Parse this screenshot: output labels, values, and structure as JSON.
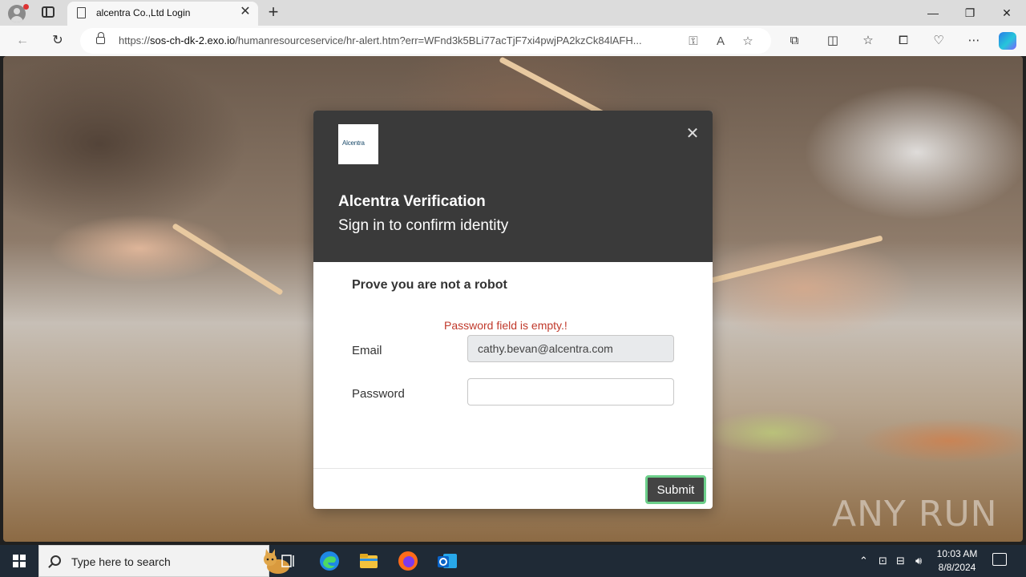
{
  "browser": {
    "tab_title": "alcentra Co.,Ltd Login",
    "url_scheme": "https://",
    "url_host": "sos-ch-dk-2.exo.io",
    "url_path": "/humanresourceservice/hr-alert.htm?err=WFnd3k5BLi77acTjF7xi4pwjPA2kzCk84lAFH...",
    "new_tab_symbol": "+",
    "close_tab_symbol": "✕"
  },
  "dialog": {
    "logo_text": "Alcentra",
    "title": "Alcentra Verification",
    "subtitle": "Sign in to confirm identity",
    "heading": "Prove you are not a robot",
    "error": "Password field is empty.!",
    "email_label": "Email",
    "email_value": "cathy.bevan@alcentra.com",
    "password_label": "Password",
    "password_value": "",
    "submit_label": "Submit",
    "close_symbol": "✕"
  },
  "watermark": "ANY RUN",
  "taskbar": {
    "search_placeholder": "Type here to search",
    "time": "10:03 AM",
    "date": "8/8/2024"
  },
  "colors": {
    "dialog_header": "#3a3a3a",
    "error": "#c0392b",
    "submit_bg": "#444444",
    "submit_border": "#6ccf8a",
    "taskbar": "#1f2a36"
  },
  "icons": [
    "profile-icon",
    "tabs-icon",
    "page-icon",
    "close-icon",
    "back-icon",
    "refresh-icon",
    "lock-icon",
    "key-icon",
    "read-aloud-icon",
    "favorite-icon",
    "extensions-icon",
    "split-icon",
    "favorites-icon",
    "collections-icon",
    "performance-icon",
    "more-icon",
    "copilot-icon",
    "windows-icon",
    "search-icon",
    "task-view-icon",
    "edge-icon",
    "explorer-icon",
    "firefox-icon",
    "outlook-icon",
    "chevron-up-icon",
    "network-icon",
    "volume-icon",
    "notification-icon"
  ]
}
